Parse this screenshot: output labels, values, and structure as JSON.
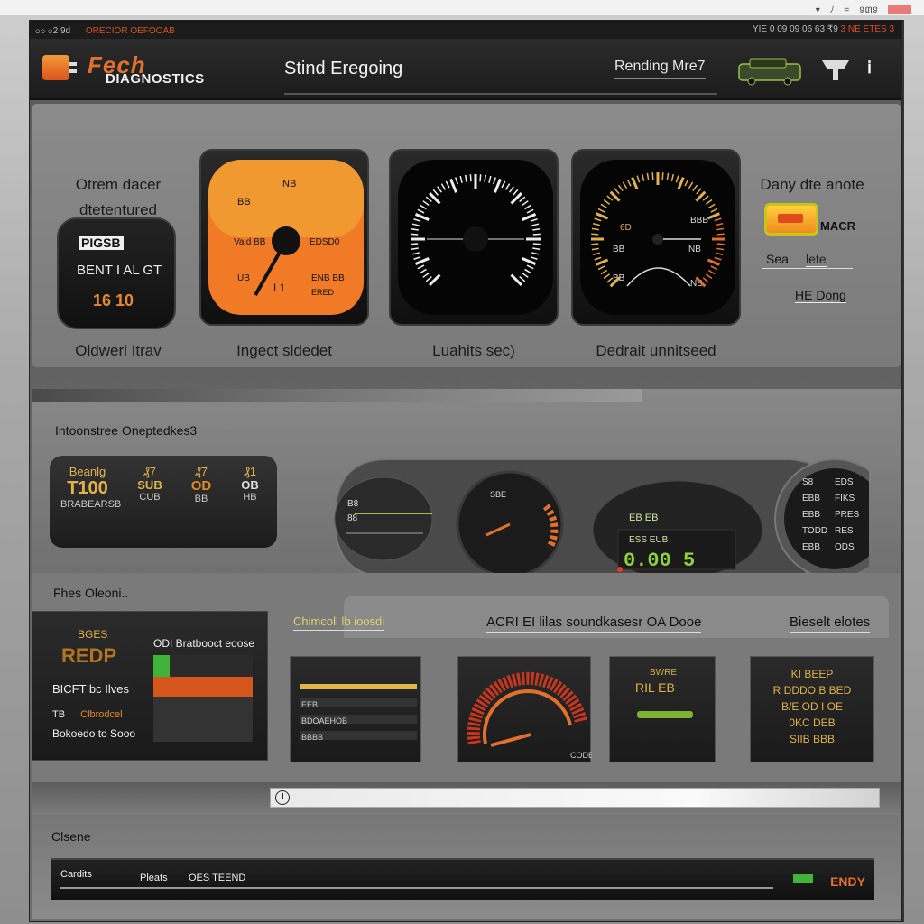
{
  "window": {
    "top_right": [
      "▾",
      "ﾉ",
      "=",
      "ទ៣ទ"
    ],
    "titlebar_left": "ဝ၁ ဝ2 9d",
    "titlebar_brand": "ORECIOR OEFOOAB",
    "titlebar_right": "YIE 0 09   09 06   63   ₹9",
    "titlebar_right2": "3 NE ETES 3"
  },
  "header": {
    "logo_main": "Fech",
    "logo_sub": "DIAGNOSTICS",
    "title": "Stind Eregoing",
    "right_label": "Rending Mre7"
  },
  "panel1": {
    "odometer": {
      "label_top": "Otrem dacer",
      "label_sub": "dtetentured",
      "box_top": "PIGSB",
      "box_mid": "BENT I AL GT",
      "box_value": "16 10",
      "caption": "Oldwerl Itrav"
    },
    "gauges": [
      {
        "caption": "Ingect sldedet",
        "labels": [
          "NB",
          "BB",
          "Vaid BB",
          "EDSD0",
          "UB",
          "L1",
          "ENB BB",
          "ERED"
        ]
      },
      {
        "caption": "Luahits sec)"
      },
      {
        "caption": "Dedrait unnitseed",
        "labels": [
          "6D",
          "BBB",
          "BB",
          "NB",
          "BB",
          "NB"
        ]
      }
    ],
    "side": {
      "label": "Dany dte anote",
      "mack": "MACR",
      "sea_a": "Sea",
      "sea_b": "lete",
      "hit": "HE Dong"
    }
  },
  "panel2": {
    "title": "Intoonstree Oneptedkes3",
    "stats": [
      {
        "top": "Beanlg",
        "value": "T100",
        "sub": "BRABEARSB"
      },
      {
        "top": "₰7",
        "value": "SUB",
        "sub": "CUB"
      },
      {
        "top": "₰7",
        "value": "OD",
        "sub": "BB"
      },
      {
        "top": "₰1",
        "value": "OB",
        "sub": "HB"
      }
    ],
    "cluster": {
      "left_labels": [
        "B8",
        "88"
      ],
      "speed_label": "SBE",
      "digital_top": "EB   EB",
      "digital_value": "0.00 5",
      "digital_sub": "ESS EUB",
      "right_rows": [
        [
          "S8",
          "EDS"
        ],
        [
          "EBB",
          "FIKS"
        ],
        [
          "EBB",
          "PRES"
        ],
        [
          "TODD",
          "RES"
        ],
        [
          "EBB",
          "ODS"
        ]
      ]
    }
  },
  "panel3": {
    "title": "Fhes Oleoni..",
    "list": {
      "top": "BGES",
      "big": "REDP",
      "head": "ODI Bratbooct eoose",
      "row1": "BICFT bc Ilves",
      "row2_a": "TB",
      "row2_b": "Clbrodcel",
      "row3": "Bokoedo to Sooo"
    },
    "tabs": [
      "Chimcoll lb  ioosdi",
      "ACRI EI lilas soundkasesr OA Dooe",
      "Bieselt elotes"
    ],
    "cards": {
      "card1_rows": [
        "EEB",
        "BDOAEHOB",
        "BBBB"
      ],
      "card2_label": "CODE",
      "card3_top": "BWRE",
      "card3_mid": "RIL EB",
      "card4_lines": [
        "KI BEEP",
        "R DDDO  B BED",
        "B/E OD I OE",
        "0KC DEB",
        "SIIB BBB"
      ]
    }
  },
  "search": {
    "placeholder": "",
    "value": ""
  },
  "bottom": {
    "title": "Clsene",
    "timeline_a": "Cardits",
    "timeline_b": "Pleats",
    "timeline_c": "OES TEEND",
    "timeline_end": "ENDY"
  },
  "colors": {
    "accent_orange": "#e0702e",
    "amber": "#e0b24a",
    "green": "#3fb33a"
  }
}
